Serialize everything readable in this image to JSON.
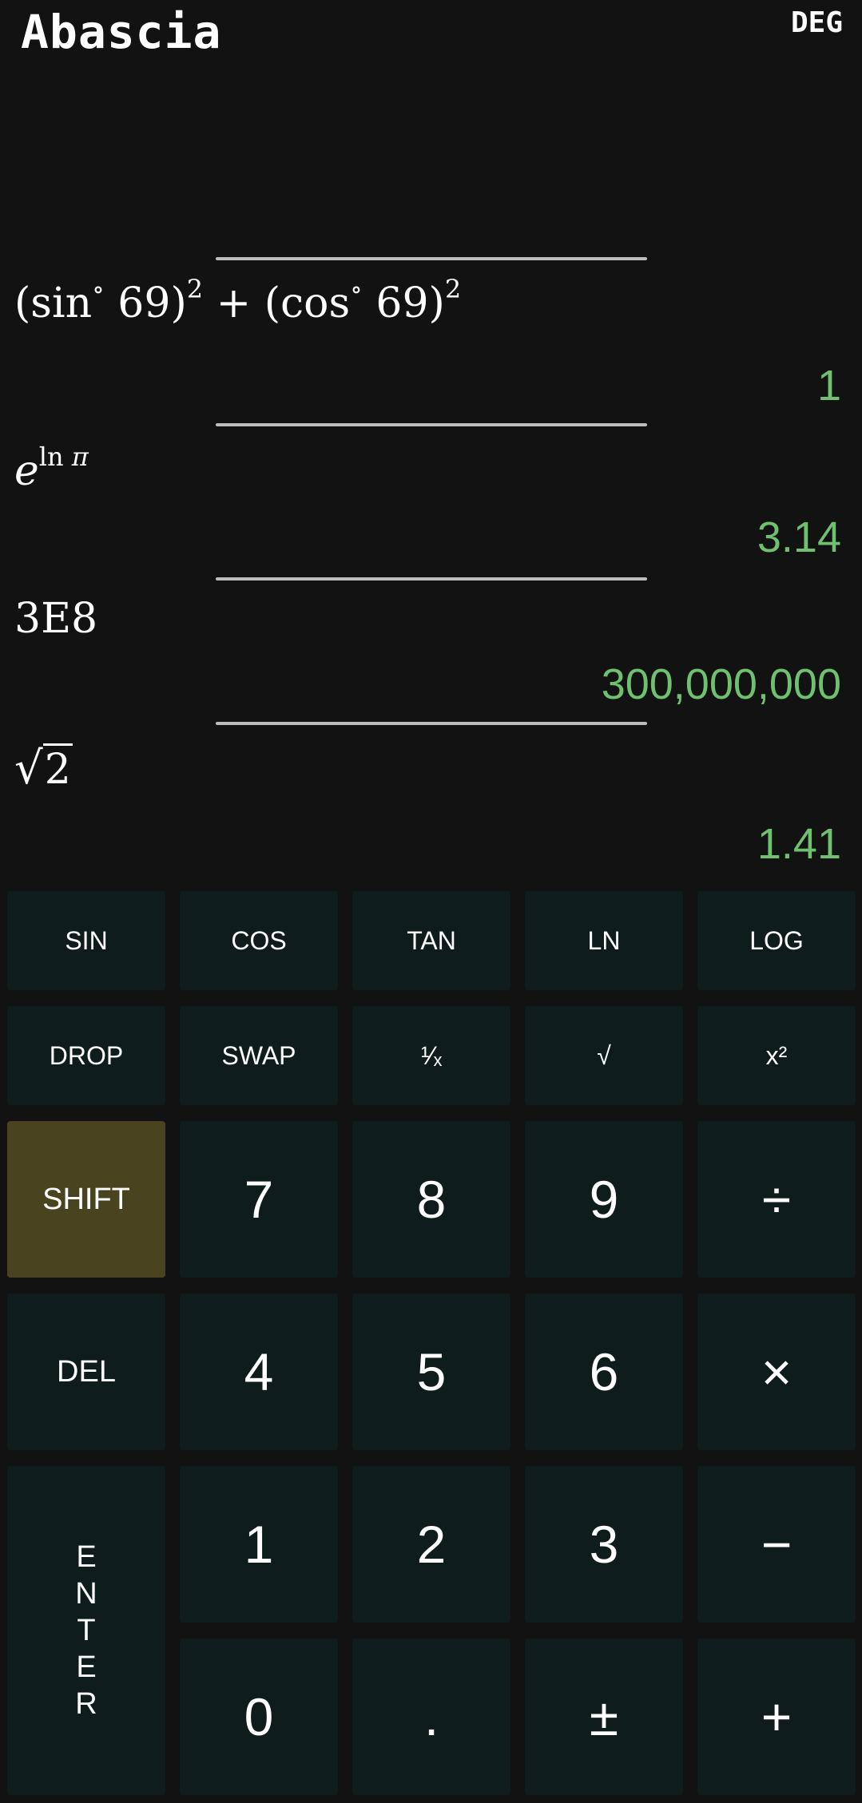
{
  "header": {
    "app_title": "Abascia",
    "angle_mode": "DEG"
  },
  "stack": [
    {
      "expression": "sin69cos69",
      "result": "1"
    },
    {
      "expression": "e^ln pi",
      "result": "3.14"
    },
    {
      "expression": "3E8",
      "result": "300,000,000"
    },
    {
      "expression": "sqrt2",
      "result": "1.41"
    }
  ],
  "keys": {
    "sin": "SIN",
    "cos": "COS",
    "tan": "TAN",
    "ln": "LN",
    "log": "LOG",
    "drop": "DROP",
    "swap": "SWAP",
    "reciprocal": "¹⁄ₓ",
    "sqrt": "√",
    "square": "x²",
    "shift": "SHIFT",
    "seven": "7",
    "eight": "8",
    "nine": "9",
    "divide": "÷",
    "del": "DEL",
    "four": "4",
    "five": "5",
    "six": "6",
    "multiply": "×",
    "one": "1",
    "two": "2",
    "three": "3",
    "minus": "−",
    "enter_letters": [
      "E",
      "N",
      "T",
      "E",
      "R"
    ],
    "zero": "0",
    "decimal": ".",
    "plus_minus": "±",
    "plus": "+"
  },
  "colors": {
    "background": "#121212",
    "result": "#6fc16f",
    "key": "#0f1c1c",
    "shift_key": "#4a4320",
    "divider": "#bdbdbd"
  }
}
